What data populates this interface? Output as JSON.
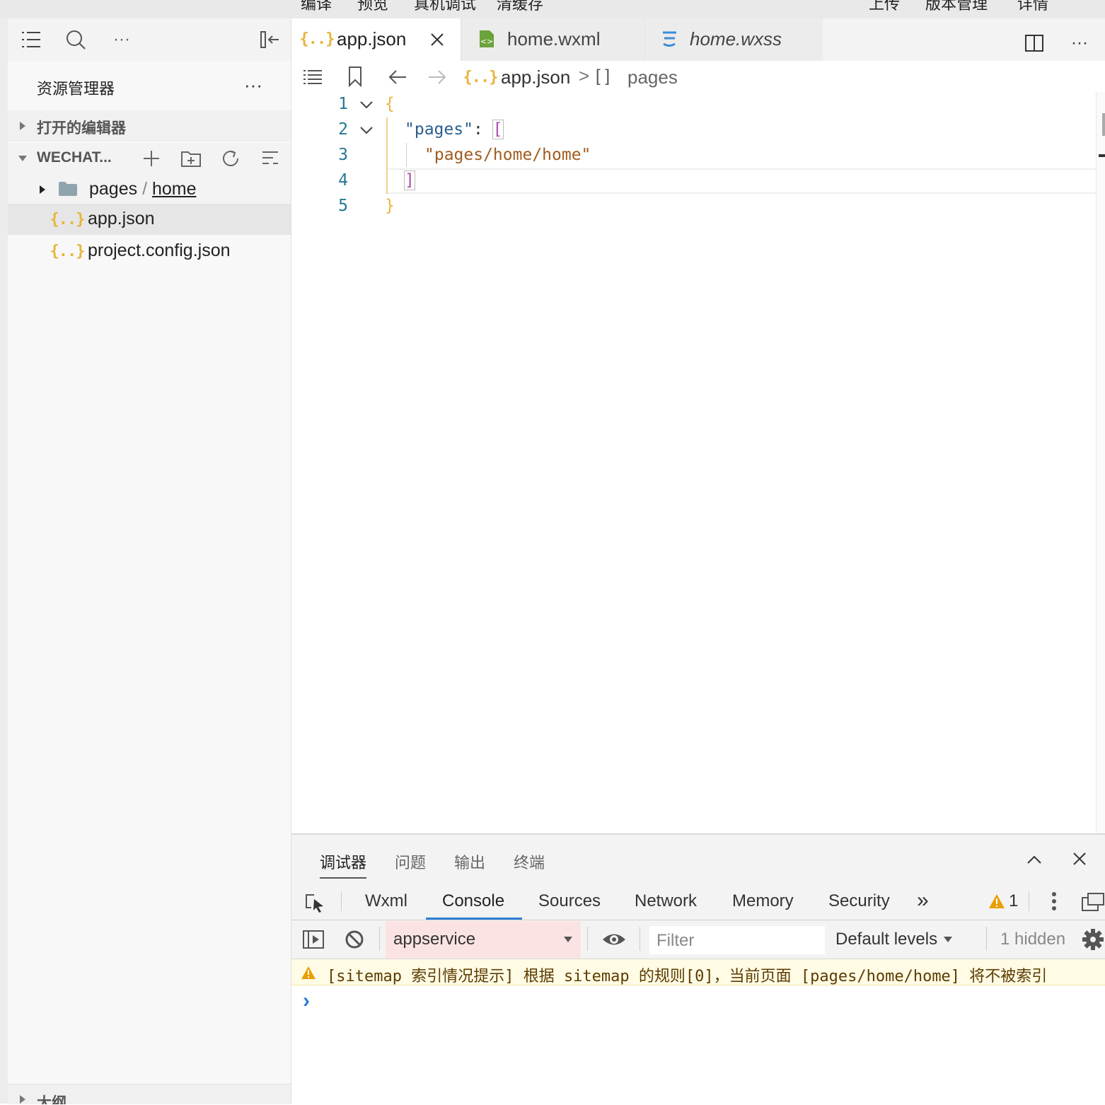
{
  "topbar": {
    "left_items": [
      "编译",
      "预览",
      "真机调试",
      "清缓存"
    ],
    "right_items": [
      "上传",
      "版本管理",
      "详情"
    ]
  },
  "sidebar": {
    "title": "资源管理器",
    "open_editors": "打开的编辑器",
    "project": "WECHAT...",
    "tree": {
      "folder_name": "pages",
      "folder_sep": "/",
      "folder_sub": "home",
      "file1": "app.json",
      "file2": "project.config.json"
    },
    "outline": "大纲"
  },
  "tabs": [
    {
      "label": "app.json",
      "icon": "json-icon",
      "active": true
    },
    {
      "label": "home.wxml",
      "icon": "wxml-file-icon",
      "active": false
    },
    {
      "label": "home.wxss",
      "icon": "css-icon",
      "active": false
    }
  ],
  "breadcrumb": {
    "file": "app.json",
    "sep": ">",
    "array_icon": "[ ]",
    "node": "pages"
  },
  "editor": {
    "line_numbers": [
      "1",
      "2",
      "3",
      "4",
      "5"
    ],
    "lines": {
      "l1": "{",
      "l2_key": "\"pages\"",
      "l2_colon": ": ",
      "l2_bracket": "[",
      "l3_value": "\"pages/home/home\"",
      "l4": "]",
      "l5": "}"
    }
  },
  "panel": {
    "tabs": [
      "调试器",
      "问题",
      "输出",
      "终端"
    ],
    "devtools_tabs": [
      "Wxml",
      "Console",
      "Sources",
      "Network",
      "Memory",
      "Security"
    ],
    "active_devtools_tab": "Console",
    "more": "»",
    "warning_count": "1",
    "context": "appservice",
    "filter_placeholder": "Filter",
    "levels": "Default levels",
    "hidden": "1 hidden",
    "warning_message": "[sitemap 索引情况提示] 根据 sitemap 的规则[0]，当前页面 [pages/home/home] 将不被索引",
    "prompt": "›"
  },
  "colors": {
    "accent": "#2e7dd7",
    "json_icon": "#e8b43c",
    "string": "#a15c1f",
    "key": "#2a5d8f",
    "bracket": "#b04ab0",
    "warning": "#e8a000"
  }
}
